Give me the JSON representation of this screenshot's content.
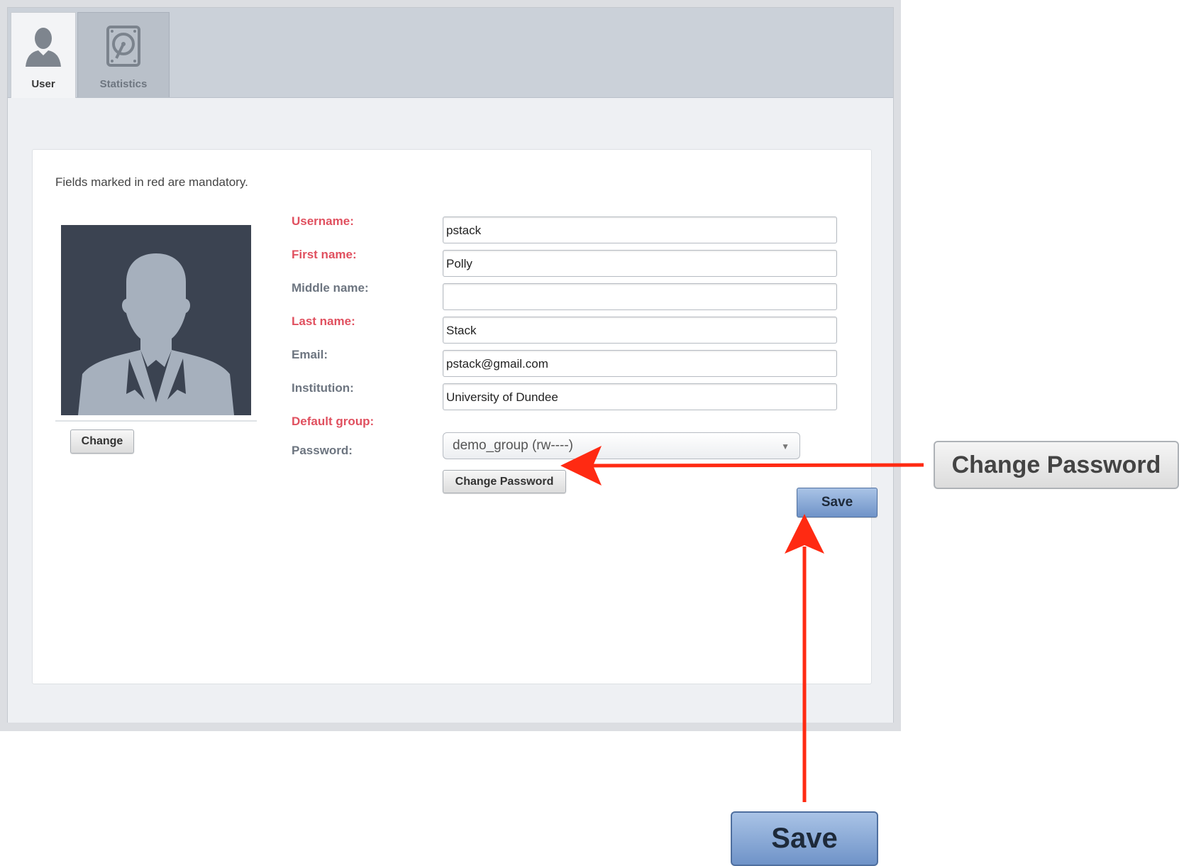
{
  "tabs": [
    {
      "label": "User",
      "icon": "user-icon"
    },
    {
      "label": "Statistics",
      "icon": "hard-drive-icon"
    }
  ],
  "form": {
    "note": "Fields marked in red are mandatory.",
    "avatar_change_label": "Change",
    "fields": [
      {
        "label": "Username:",
        "value": "pstack",
        "required": true
      },
      {
        "label": "First name:",
        "value": "Polly",
        "required": true
      },
      {
        "label": "Middle name:",
        "value": "",
        "required": false
      },
      {
        "label": "Last name:",
        "value": "Stack",
        "required": true
      },
      {
        "label": "Email:",
        "value": "pstack@gmail.com",
        "required": false
      },
      {
        "label": "Institution:",
        "value": "University of Dundee",
        "required": false
      }
    ],
    "default_group": {
      "label": "Default group:",
      "value": "demo_group (rw----)",
      "required": true
    },
    "password": {
      "label": "Password:",
      "button_label": "Change Password"
    },
    "save_label": "Save"
  },
  "annotations": {
    "change_password_callout": "Change Password",
    "save_callout": "Save",
    "arrow_color": "#ff2a12"
  },
  "colors": {
    "required_label": "#e0505f",
    "optional_label": "#6d7580",
    "save_button": "#7f9fd0"
  }
}
